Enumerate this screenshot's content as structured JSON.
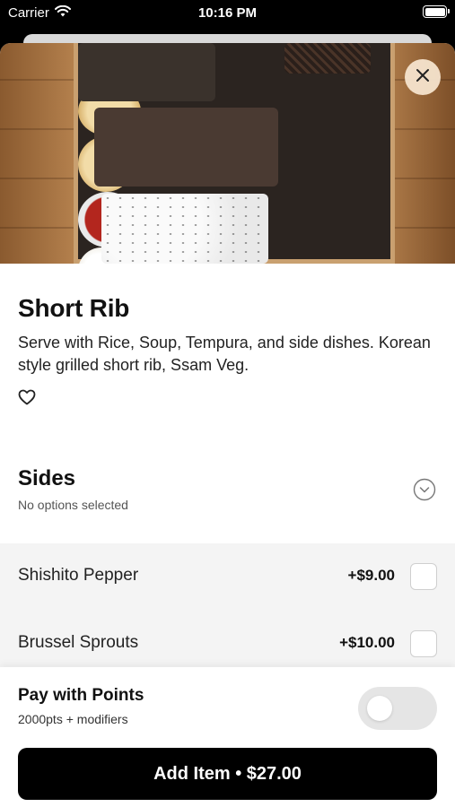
{
  "status_bar": {
    "carrier": "Carrier",
    "time": "10:16 PM",
    "wifi_icon": "wifi-icon",
    "battery_icon": "battery-icon"
  },
  "item": {
    "name": "Short Rib",
    "description": "Serve with Rice, Soup, Tempura, and side dishes. Korean style grilled short rib, Ssam Veg.",
    "close_icon": "close-icon",
    "favorite_icon": "heart-outline-icon"
  },
  "sides": {
    "title": "Sides",
    "subtitle": "No options selected",
    "expand_icon": "chevron-down-circle-icon",
    "options": [
      {
        "name": "Shishito Pepper",
        "price": "+$9.00",
        "selected": false
      },
      {
        "name": "Brussel Sprouts",
        "price": "+$10.00",
        "selected": false
      }
    ]
  },
  "points": {
    "title": "Pay with Points",
    "subtitle": "2000pts + modifiers",
    "enabled": false
  },
  "cta": {
    "label": "Add Item • $27.00"
  },
  "colors": {
    "primary_button": "#000000",
    "options_background": "#f4f4f4",
    "toggle_off": "#e5e5e5"
  }
}
